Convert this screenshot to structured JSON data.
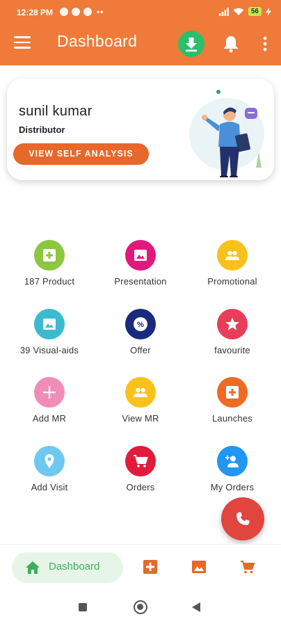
{
  "status_bar": {
    "time": "12:28 PM",
    "dots": "••",
    "battery": "56"
  },
  "app_bar": {
    "title": "Dashboard",
    "icons": [
      "menu-icon",
      "download-icon",
      "bell-icon",
      "kebab-icon"
    ],
    "colors": {
      "background": "#f07a3a",
      "download": "#2bbf6a"
    }
  },
  "profile": {
    "name": "sunil kumar",
    "role": "Distributor",
    "analysis_button": "VIEW SELF ANALYSIS",
    "button_color": "#e8672a"
  },
  "grid": [
    {
      "label": "187 Product",
      "icon": "plus-box-icon",
      "color": "#8dc63f"
    },
    {
      "label": "Presentation",
      "icon": "image-icon",
      "color": "#e0197d"
    },
    {
      "label": "Promotional",
      "icon": "people-icon",
      "color": "#f9c11b"
    },
    {
      "label": "39 Visual-aids",
      "icon": "image-icon",
      "color": "#3bbad0"
    },
    {
      "label": "Offer",
      "icon": "percent-icon",
      "color": "#1a2a7c"
    },
    {
      "label": "favourite",
      "icon": "star-icon",
      "color": "#e83d5b"
    },
    {
      "label": "Add MR",
      "icon": "plus-icon",
      "color": "#f08db7"
    },
    {
      "label": "View MR",
      "icon": "people-icon",
      "color": "#f9c11b"
    },
    {
      "label": "Launches",
      "icon": "plus-box-icon",
      "color": "#f06b22"
    },
    {
      "label": "Add Visit",
      "icon": "location-icon",
      "color": "#6fc8f0"
    },
    {
      "label": "Orders",
      "icon": "cart-icon",
      "color": "#e01b3c"
    },
    {
      "label": "My Orders",
      "icon": "account-icon",
      "color": "#2196f3"
    }
  ],
  "fab": {
    "icon": "phone-icon",
    "color": "#e0453e"
  },
  "bottom_nav": {
    "items": [
      {
        "label": "Dashboard",
        "icon": "home-icon",
        "active": true
      },
      {
        "label": "",
        "icon": "plus-box-icon",
        "active": false
      },
      {
        "label": "",
        "icon": "image-icon",
        "active": false
      },
      {
        "label": "",
        "icon": "cart-icon",
        "active": false
      }
    ],
    "active_color": "#3fae5c",
    "icon_color": "#e8672a"
  },
  "system_nav": {
    "icons": [
      "recents-icon",
      "home-circle-icon",
      "back-icon"
    ]
  }
}
